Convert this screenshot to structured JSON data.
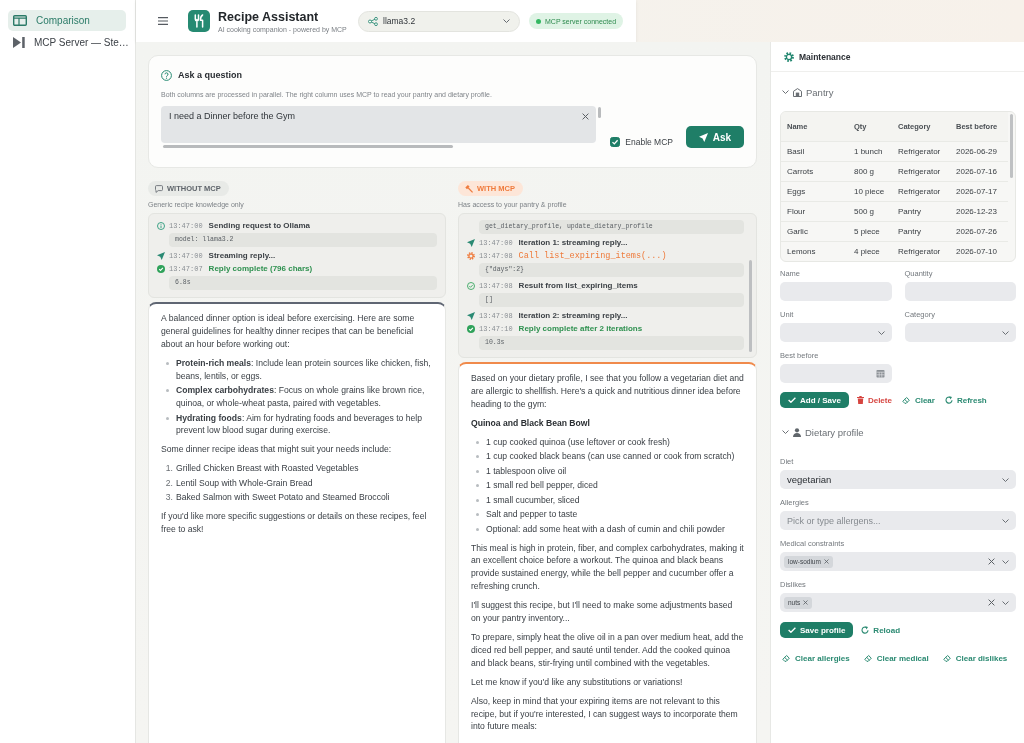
{
  "sidebar": {
    "items": [
      {
        "label": "Comparison",
        "kind": "compare",
        "selected": true
      },
      {
        "label": "MCP Server — Ste…",
        "kind": "server",
        "selected": false
      }
    ]
  },
  "header": {
    "title": "Recipe Assistant",
    "subtitle": "AI cooking companion - powered by MCP",
    "model": "llama3.2",
    "status": "MCP server connected",
    "connected": true
  },
  "ask": {
    "title": "Ask a question",
    "description": "Both columns are processed in parallel. The right column uses MCP to read your pantry and dietary profile.",
    "question": "I need a Dinner before the Gym",
    "enable_mcp": {
      "label": "Enable MCP",
      "checked": true
    },
    "button": "Ask"
  },
  "columns": [
    {
      "kind": "plain",
      "badge": "WITHOUT MCP",
      "subtitle": "Generic recipe knowledge only",
      "log": [
        {
          "kind": "info",
          "time": "13:47:00",
          "text": "Sending request to Ollama",
          "detail": "model: llama3.2"
        },
        {
          "kind": "stream",
          "time": "13:47:00",
          "text": "Streaming reply..."
        },
        {
          "kind": "done",
          "time": "13:47:07",
          "text": "Reply complete (796 chars)",
          "detail": "6.8s"
        }
      ],
      "response": [
        {
          "kind": "p",
          "text": "A balanced dinner option is ideal before exercising. Here are some general guidelines for healthy dinner recipes that can be beneficial about an hour before working out:"
        },
        {
          "kind": "ul",
          "items": [
            "**Protein-rich meals**: Include lean protein sources like chicken, fish, beans, lentils, or eggs.",
            "**Complex carbohydrates**: Focus on whole grains like brown rice, quinoa, or whole-wheat pasta, paired with vegetables.",
            "**Hydrating foods**: Aim for hydrating foods and beverages to help prevent low blood sugar during exercise."
          ]
        },
        {
          "kind": "p",
          "text": "Some dinner recipe ideas that might suit your needs include:"
        },
        {
          "kind": "ol",
          "items": [
            {
              "number": "1.",
              "text": "Grilled Chicken Breast with Roasted Vegetables"
            },
            {
              "number": "2.",
              "text": "Lentil Soup with Whole-Grain Bread"
            },
            {
              "number": "3.",
              "text": "Baked Salmon with Sweet Potato and Steamed Broccoli"
            }
          ]
        },
        {
          "kind": "p",
          "text": "If you'd like more specific suggestions or details on these recipes, feel free to ask!"
        }
      ]
    },
    {
      "kind": "mcp",
      "badge": "WITH MCP",
      "subtitle": "Has access to your pantry & profile",
      "log": [
        {
          "kind": "detail",
          "detail": "get_dietary_profile, update_dietary_profile"
        },
        {
          "kind": "stream",
          "time": "13:47:00",
          "text": "Iteration 1: streaming reply..."
        },
        {
          "kind": "tool",
          "time": "13:47:08",
          "text": "Call list_expiring_items(...)",
          "detail": "{\"days\":2}"
        },
        {
          "kind": "result",
          "time": "13:47:08",
          "text": "Result from list_expiring_items",
          "detail": "[]"
        },
        {
          "kind": "stream",
          "time": "13:47:08",
          "text": "Iteration 2: streaming reply..."
        },
        {
          "kind": "done",
          "time": "13:47:10",
          "text": "Reply complete after 2 iterations",
          "detail": "10.3s"
        }
      ],
      "response": [
        {
          "kind": "p",
          "text": "Based on your dietary profile, I see that you follow a vegetarian diet and are allergic to shellfish. Here's a quick and nutritious dinner idea before heading to the gym:"
        },
        {
          "kind": "heading",
          "text": "Quinoa and Black Bean Bowl"
        },
        {
          "kind": "ul",
          "items": [
            "1 cup cooked quinoa (use leftover or cook fresh)",
            "1 cup cooked black beans (can use canned or cook from scratch)",
            "1 tablespoon olive oil",
            "1 small red bell pepper, diced",
            "1 small cucumber, sliced",
            "Salt and pepper to taste",
            "Optional: add some heat with a dash of cumin and chili powder"
          ]
        },
        {
          "kind": "p",
          "text": "This meal is high in protein, fiber, and complex carbohydrates, making it an excellent choice before a workout. The quinoa and black beans provide sustained energy, while the bell pepper and cucumber offer a refreshing crunch."
        },
        {
          "kind": "p",
          "text": "I'll suggest this recipe, but I'll need to make some adjustments based on your pantry inventory..."
        },
        {
          "kind": "p",
          "text": "To prepare, simply heat the olive oil in a pan over medium heat, add the diced red bell pepper, and sauté until tender. Add the cooked quinoa and black beans, stir-frying until combined with the vegetables."
        },
        {
          "kind": "p",
          "text": "Let me know if you'd like any substitutions or variations!"
        },
        {
          "kind": "p",
          "text": "Also, keep in mind that your expiring items are not relevant to this recipe, but if you're interested, I can suggest ways to incorporate them into future meals:"
        }
      ]
    }
  ],
  "maintenance": {
    "title": "Maintenance",
    "pantry": {
      "title": "Pantry",
      "expanded": true,
      "columns": [
        "Name",
        "Qty",
        "Category",
        "Best before"
      ],
      "rows": [
        [
          "Basil",
          "1 bunch",
          "Refrigerator",
          "2026-06-29"
        ],
        [
          "Carrots",
          "800 g",
          "Refrigerator",
          "2026-07-16"
        ],
        [
          "Eggs",
          "10 piece",
          "Refrigerator",
          "2026-07-17"
        ],
        [
          "Flour",
          "500 g",
          "Pantry",
          "2026-12-23"
        ],
        [
          "Garlic",
          "5 piece",
          "Pantry",
          "2026-07-26"
        ],
        [
          "Lemons",
          "4 piece",
          "Refrigerator",
          "2026-07-10"
        ]
      ],
      "fields": [
        {
          "label": "Name",
          "kind": "text"
        },
        {
          "label": "Quantity",
          "kind": "text"
        },
        {
          "label": "Unit",
          "kind": "select"
        },
        {
          "label": "Category",
          "kind": "select"
        },
        {
          "label": "Best before",
          "kind": "date"
        }
      ],
      "actions": [
        {
          "label": "Add / Save",
          "kind": "primary"
        },
        {
          "label": "Delete",
          "kind": "danger"
        },
        {
          "label": "Clear",
          "kind": "clear"
        },
        {
          "label": "Refresh",
          "kind": "refresh"
        }
      ]
    },
    "profile": {
      "title": "Dietary profile",
      "expanded": true,
      "fields": [
        {
          "label": "Diet",
          "kind": "select",
          "value": "vegetarian"
        },
        {
          "label": "Allergies",
          "kind": "multi",
          "placeholder": "Pick or type allergens..."
        },
        {
          "label": "Medical constraints",
          "kind": "multi",
          "chips": [
            "low-sodium"
          ]
        },
        {
          "label": "Dislikes",
          "kind": "multi",
          "chips": [
            "nuts"
          ]
        }
      ],
      "actions": [
        {
          "label": "Save profile",
          "kind": "primary"
        },
        {
          "label": "Reload",
          "kind": "refresh"
        }
      ],
      "clear_actions": [
        "Clear allergies",
        "Clear medical",
        "Clear dislikes"
      ]
    }
  }
}
